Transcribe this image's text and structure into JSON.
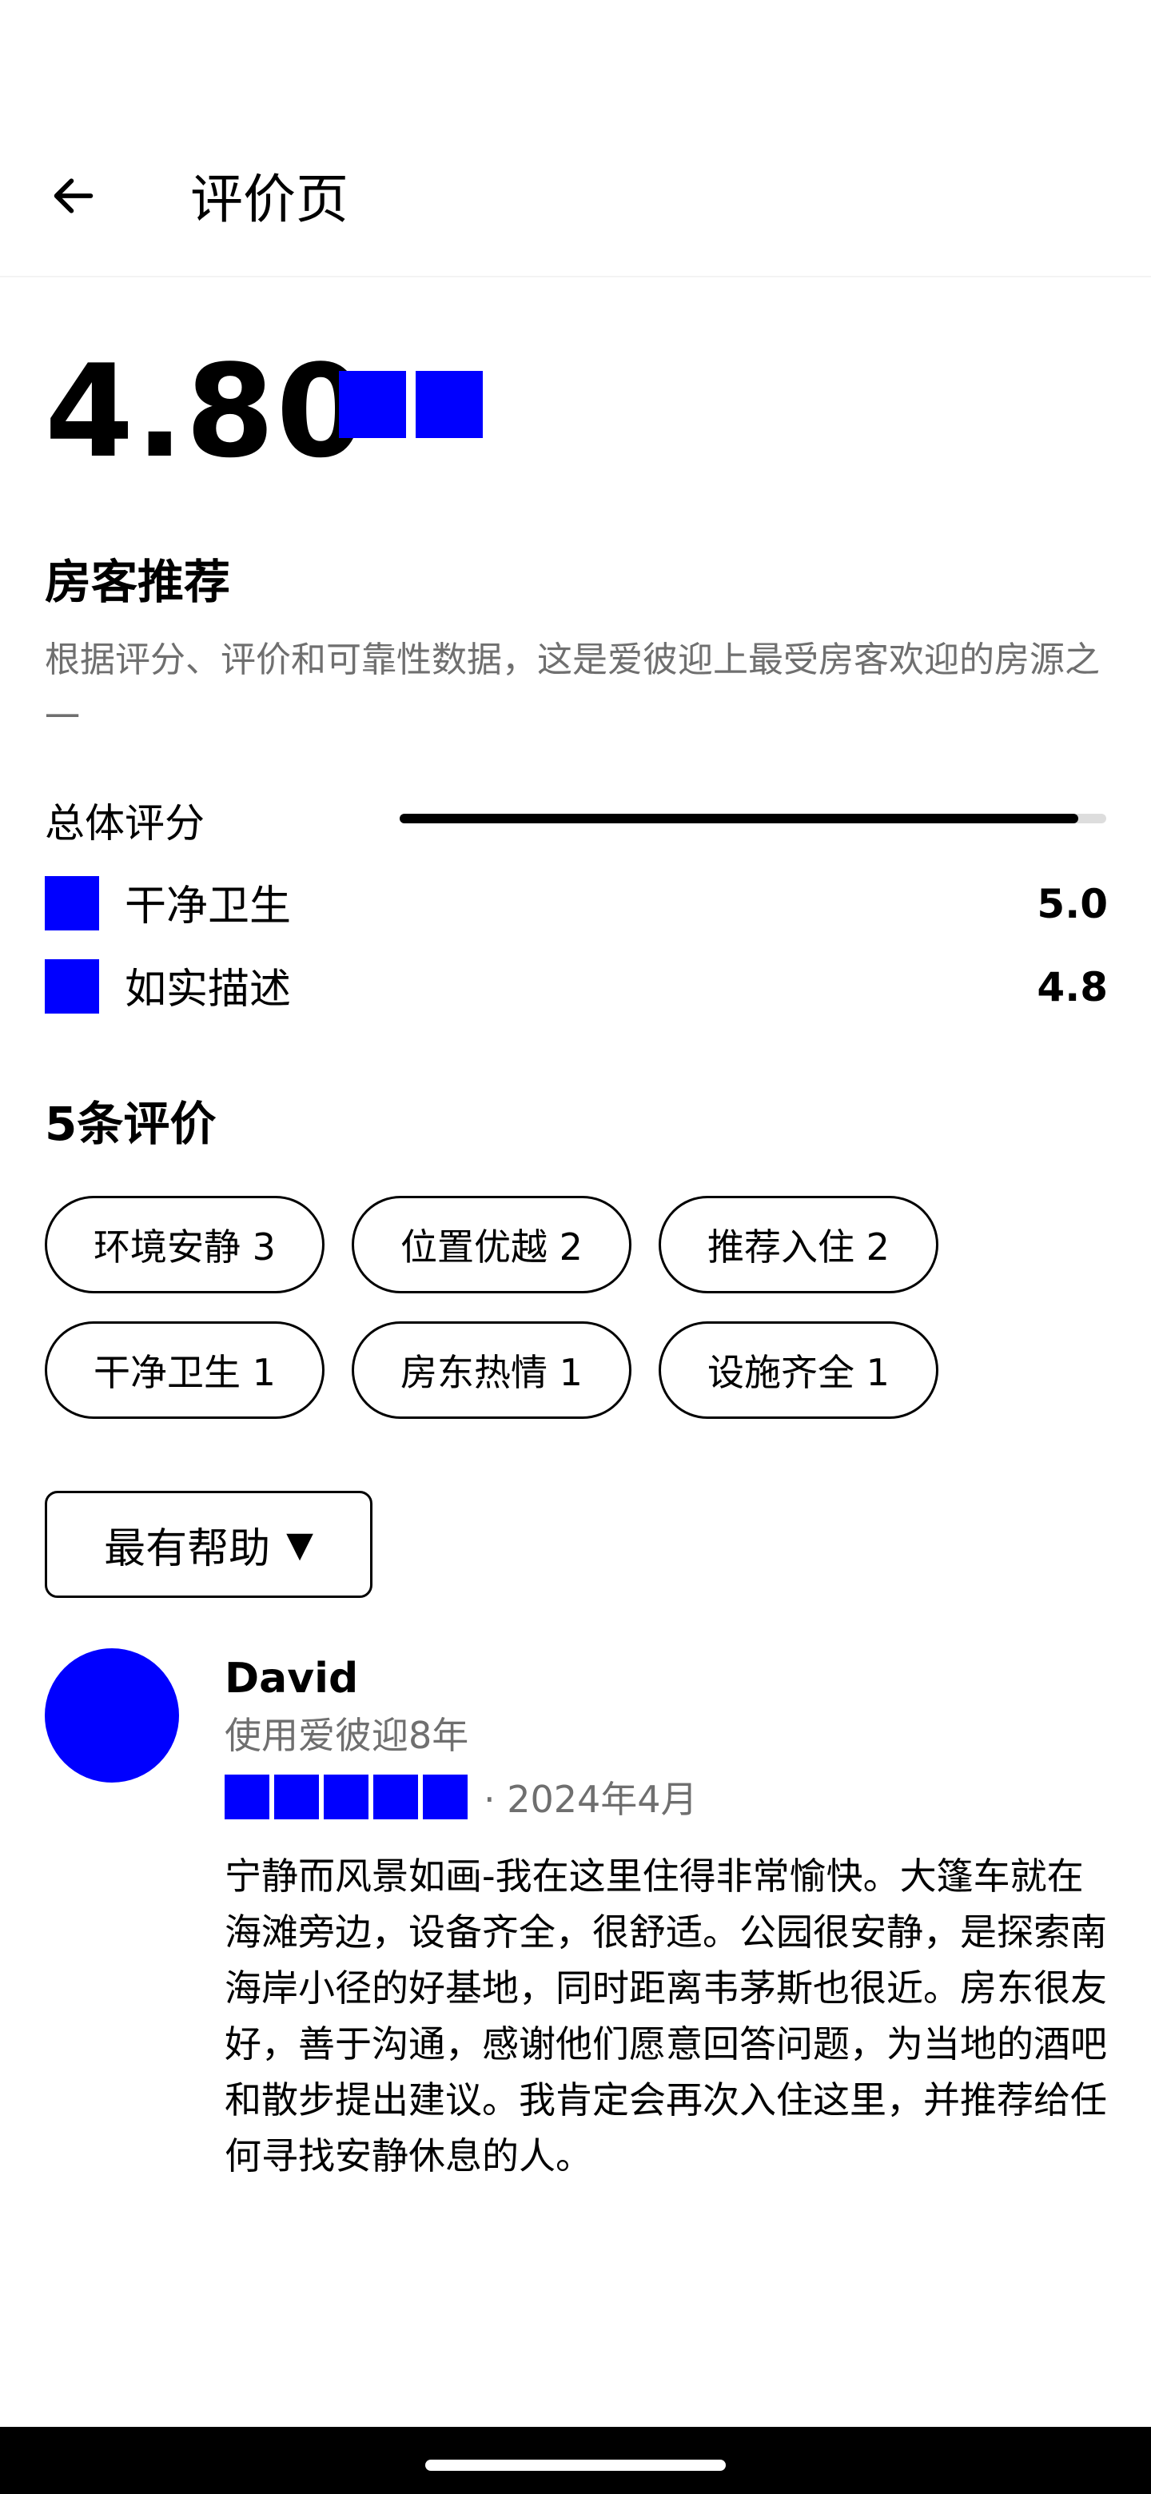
{
  "header": {
    "title": "评价页"
  },
  "rating": {
    "value": "4.80"
  },
  "recommend": {
    "title": "房客推荐",
    "description": "根据评分、评价和可靠性数据，这是爱彼迎上最受房客欢迎的房源之一"
  },
  "overall": {
    "label": "总体评分",
    "fill_fraction": 0.96
  },
  "categories": [
    {
      "label": "干净卫生",
      "score": "5.0"
    },
    {
      "label": "如实描述",
      "score": "4.8"
    }
  ],
  "reviews_section": {
    "title": "5条评价"
  },
  "tags": [
    "环境安静 3",
    "位置优越 2",
    "推荐入住 2",
    "干净卫生 1",
    "房东热情 1",
    "设施齐全 1"
  ],
  "sort": {
    "label": "最有帮助",
    "caret": "▼"
  },
  "review": {
    "name": "David",
    "tenure": "使用爱彼迎8年",
    "stars": 5,
    "date": "· 2024年4月",
    "text": "宁静而风景如画-我在这里住得非常愉快。大篷车就在海滩旁边，设备齐全，很舒适。公园很安静，是探索南海岸小径的好基地，同时距离韦茅斯也很近。房东很友好，善于沟通，感谢他们愿意回答问题，为当地的酒吧和散步提出建议。我肯定会再次入住这里，并推荐给任何寻找安静休息的人。"
  },
  "colors": {
    "accent": "#0000ff",
    "muted_text": "#6f6f6f"
  }
}
